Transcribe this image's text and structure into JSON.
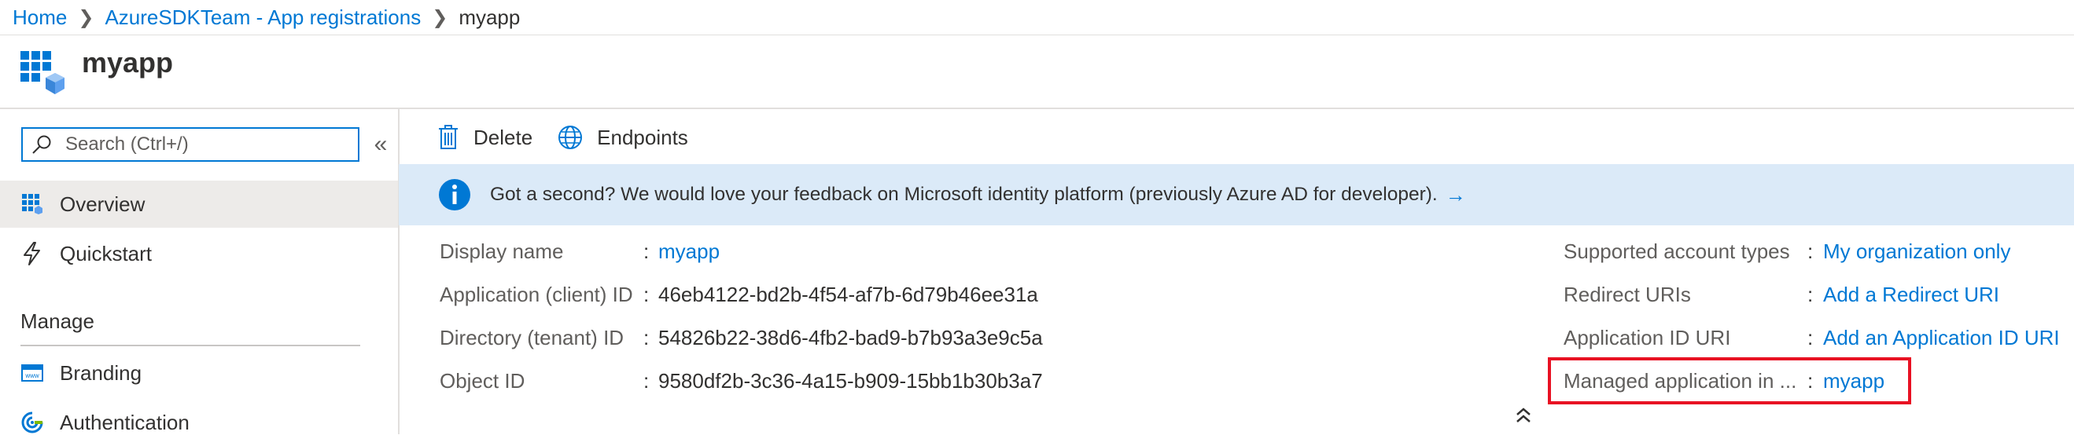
{
  "breadcrumb": {
    "items": [
      "Home",
      "AzureSDKTeam - App registrations"
    ],
    "current": "myapp"
  },
  "header": {
    "title": "myapp",
    "icon": "app-registration-icon"
  },
  "sidebar": {
    "search_placeholder": "Search (Ctrl+/)",
    "items": [
      {
        "label": "Overview",
        "icon": "overview-grid-icon",
        "active": true
      },
      {
        "label": "Quickstart",
        "icon": "lightning-icon",
        "active": false
      }
    ],
    "section_manage": "Manage",
    "manage_items": [
      {
        "label": "Branding",
        "icon": "www-icon"
      },
      {
        "label": "Authentication",
        "icon": "authentication-icon"
      }
    ]
  },
  "toolbar": {
    "delete_label": "Delete",
    "endpoints_label": "Endpoints"
  },
  "banner": {
    "text": "Got a second? We would love your feedback on Microsoft identity platform (previously Azure AD for developer).",
    "arrow": "→"
  },
  "essentials": {
    "left": [
      {
        "label": "Display name",
        "value": "myapp",
        "is_link": true
      },
      {
        "label": "Application (client) ID",
        "value": "46eb4122-bd2b-4f54-af7b-6d79b46ee31a",
        "is_link": false
      },
      {
        "label": "Directory (tenant) ID",
        "value": "54826b22-38d6-4fb2-bad9-b7b93a3e9c5a",
        "is_link": false
      },
      {
        "label": "Object ID",
        "value": "9580df2b-3c36-4a15-b909-15bb1b30b3a7",
        "is_link": false
      }
    ],
    "right": [
      {
        "label": "Supported account types",
        "value": "My organization only",
        "is_link": true
      },
      {
        "label": "Redirect URIs",
        "value": "Add a Redirect URI",
        "is_link": true
      },
      {
        "label": "Application ID URI",
        "value": "Add an Application ID URI",
        "is_link": true
      },
      {
        "label": "Managed application in ...",
        "value": "myapp",
        "is_link": true
      }
    ],
    "separator": ":"
  },
  "colors": {
    "accent": "#0078d4",
    "banner_bg": "#dbeaf8",
    "highlight": "#e81123"
  }
}
